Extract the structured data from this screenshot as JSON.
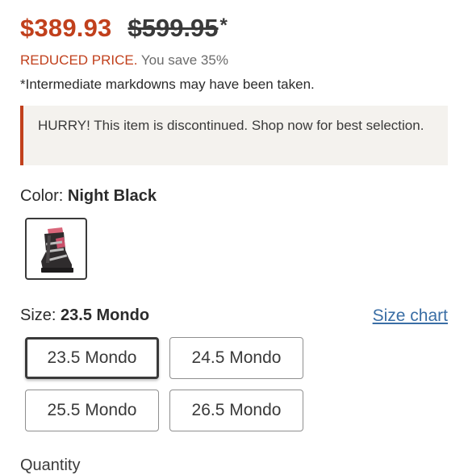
{
  "price": {
    "current": "$389.93",
    "original": "$599.95",
    "asterisk": "*"
  },
  "discount": {
    "label": "REDUCED PRICE.",
    "savings": "You save 35%"
  },
  "markdown_note": "*Intermediate markdowns may have been taken.",
  "alert": {
    "text": "HURRY! This item is discontinued. Shop now for best selection."
  },
  "color": {
    "label": "Color:",
    "value": "Night Black"
  },
  "size": {
    "label": "Size:",
    "value": "23.5 Mondo",
    "chart_link": "Size chart",
    "options": [
      "23.5 Mondo",
      "24.5 Mondo",
      "25.5 Mondo",
      "26.5 Mondo"
    ]
  },
  "quantity": {
    "label": "Quantity"
  },
  "colors": {
    "accent": "#c1401c",
    "link": "#3a6ea5",
    "alert_bg": "#f4f2ee"
  }
}
